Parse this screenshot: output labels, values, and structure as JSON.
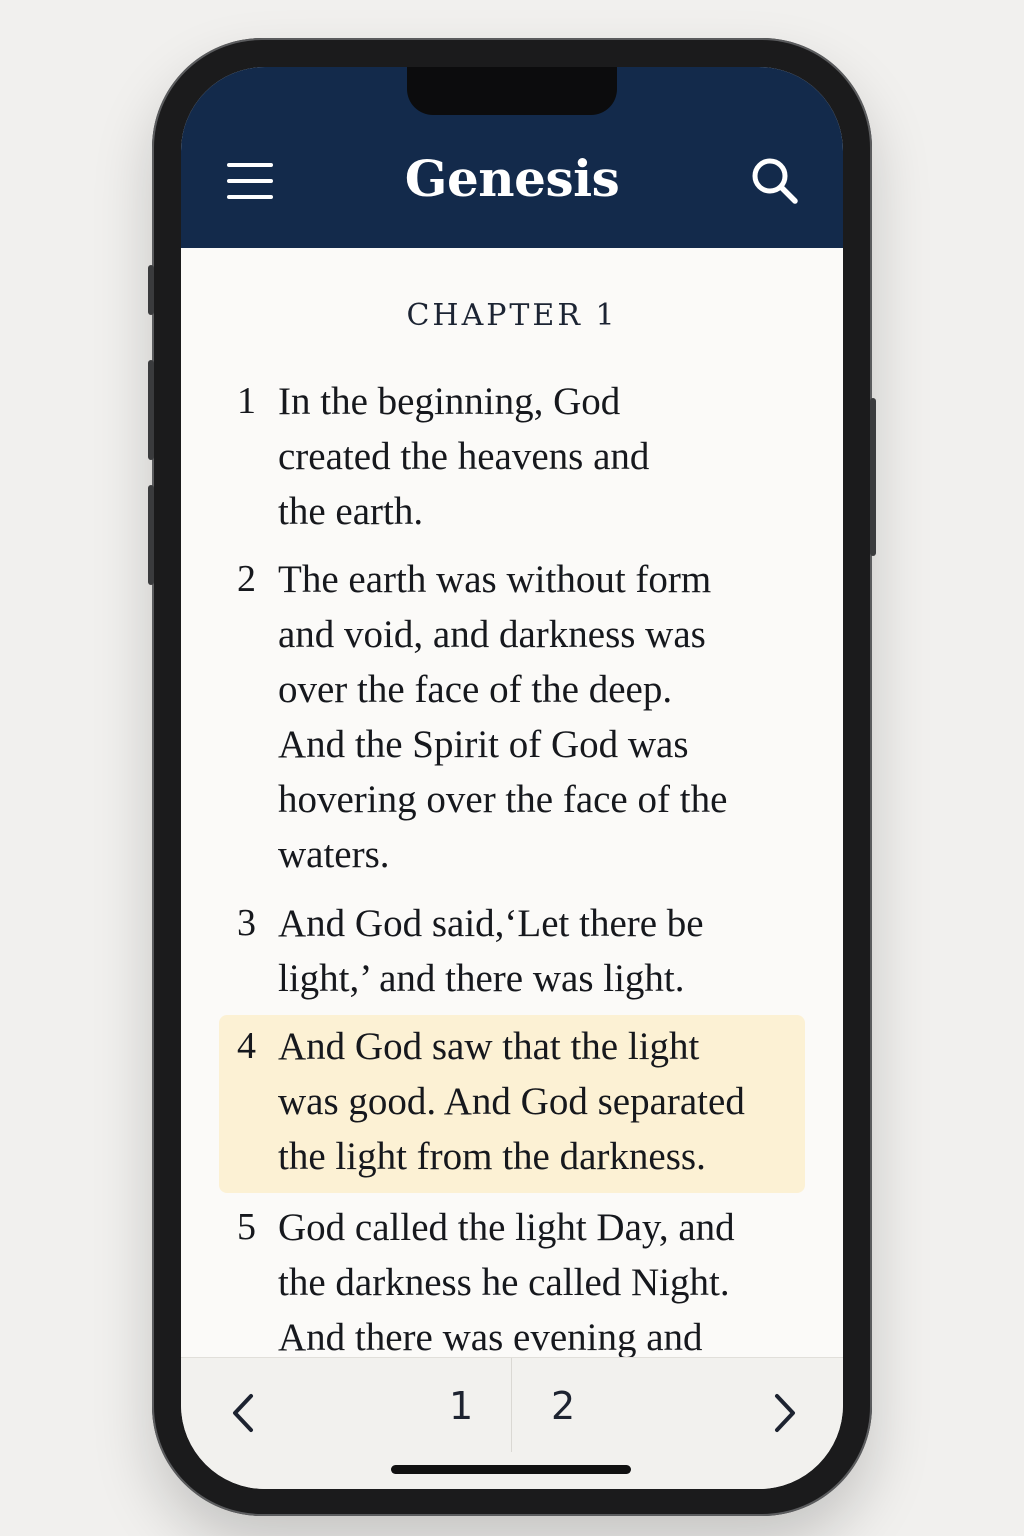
{
  "header": {
    "title": "Genesis",
    "menu_icon": "hamburger-menu-icon",
    "search_icon": "search-icon",
    "background_color": "#132a4b"
  },
  "chapter": {
    "heading": "CHAPTER 1"
  },
  "verses": [
    {
      "number": "1",
      "text": "In the beginning, God\ncreated the heavens and\nthe earth."
    },
    {
      "number": "2",
      "text": "The earth was without form\nand void, and darkness was\nover the face of the deep.\nAnd the Spirit of God was\nhovering over the face of the\nwaters."
    },
    {
      "number": "3",
      "text": "And God said,‘Let there be\nlight,’ and there was light."
    },
    {
      "number": "4",
      "text": "And God saw that the light\nwas good. And God separated\nthe light from the darkness.",
      "highlighted": true,
      "highlight_color": "#fcf1d4"
    },
    {
      "number": "5",
      "text": "God called the light Day, and\nthe darkness he called Night.\nAnd there was evening and"
    }
  ],
  "footer": {
    "prev_icon": "chevron-left-icon",
    "next_icon": "chevron-right-icon",
    "pages": [
      "1",
      "2"
    ]
  }
}
